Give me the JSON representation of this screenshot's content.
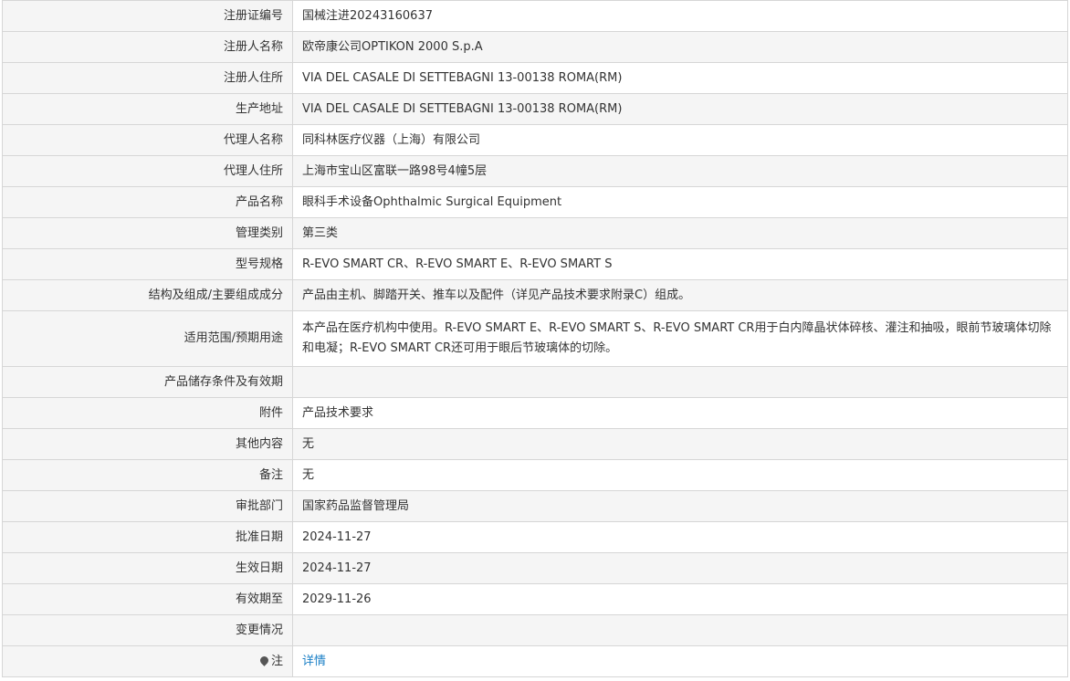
{
  "rows": [
    {
      "label": "注册证编号",
      "value": "国械注进20243160637"
    },
    {
      "label": "注册人名称",
      "value": "欧帝康公司OPTIKON 2000 S.p.A"
    },
    {
      "label": "注册人住所",
      "value": "VIA DEL CASALE DI SETTEBAGNI 13-00138 ROMA(RM)"
    },
    {
      "label": "生产地址",
      "value": "VIA DEL CASALE DI SETTEBAGNI 13-00138 ROMA(RM)"
    },
    {
      "label": "代理人名称",
      "value": "同科林医疗仪器（上海）有限公司"
    },
    {
      "label": "代理人住所",
      "value": "上海市宝山区富联一路98号4幢5层"
    },
    {
      "label": "产品名称",
      "value": "眼科手术设备Ophthalmic Surgical Equipment"
    },
    {
      "label": "管理类别",
      "value": "第三类"
    },
    {
      "label": "型号规格",
      "value": "R-EVO SMART CR、R-EVO SMART E、R-EVO SMART S"
    },
    {
      "label": "结构及组成/主要组成成分",
      "value": "产品由主机、脚踏开关、推车以及配件（详见产品技术要求附录C）组成。"
    },
    {
      "label": "适用范围/预期用途",
      "value": "本产品在医疗机构中使用。R-EVO SMART E、R-EVO SMART S、R-EVO SMART CR用于白内障晶状体碎核、灌注和抽吸，眼前节玻璃体切除和电凝；R-EVO SMART CR还可用于眼后节玻璃体的切除。"
    },
    {
      "label": "产品储存条件及有效期",
      "value": ""
    },
    {
      "label": "附件",
      "value": "产品技术要求"
    },
    {
      "label": "其他内容",
      "value": "无"
    },
    {
      "label": "备注",
      "value": "无"
    },
    {
      "label": "审批部门",
      "value": "国家药品监督管理局"
    },
    {
      "label": "批准日期",
      "value": "2024-11-27"
    },
    {
      "label": "生效日期",
      "value": "2024-11-27"
    },
    {
      "label": "有效期至",
      "value": "2029-11-26"
    },
    {
      "label": "变更情况",
      "value": ""
    }
  ],
  "note": {
    "label": "注",
    "icon": "pin-icon",
    "link_text": "详情"
  },
  "colors": {
    "label_bg": "#f5f5f5",
    "border": "#d6d6d6",
    "link": "#1a7fc6"
  }
}
